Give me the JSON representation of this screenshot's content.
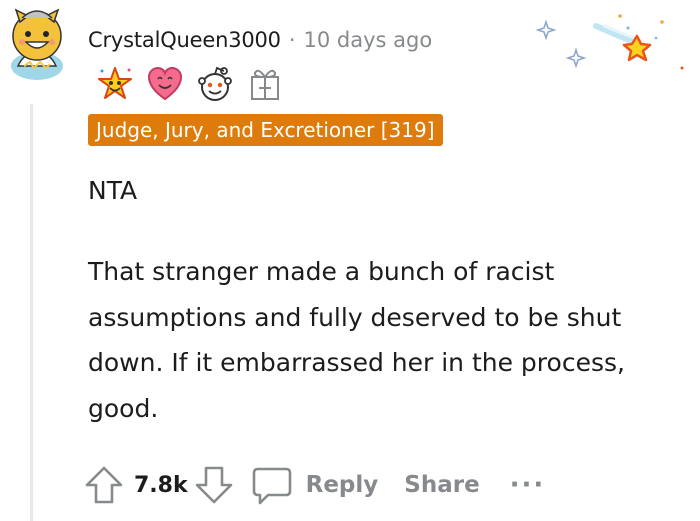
{
  "comment": {
    "author": {
      "username": "CrystalQueen3000",
      "avatar_icon": "snoo-avatar-icon"
    },
    "separator": "·",
    "timestamp": "10 days ago",
    "awards": [
      "star-struck-award-icon",
      "heart-eyes-award-icon",
      "snoo-award-icon",
      "add-award-gift-icon"
    ],
    "flair": {
      "text": "Judge, Jury, and Excretioner [319]",
      "background": "#dd7c0c",
      "color": "#ffffff"
    },
    "verdict": "NTA",
    "body": "That stranger made a bunch of racist assumptions and fully deserved to be shut down. If it embarrassed her in the process, good.",
    "score": "7.8k",
    "actions": {
      "reply_label": "Reply",
      "share_label": "Share",
      "more_label": "···"
    },
    "colors": {
      "text": "#1c1c1c",
      "muted": "#878a8c",
      "thread_line": "#e5e7ea"
    }
  }
}
